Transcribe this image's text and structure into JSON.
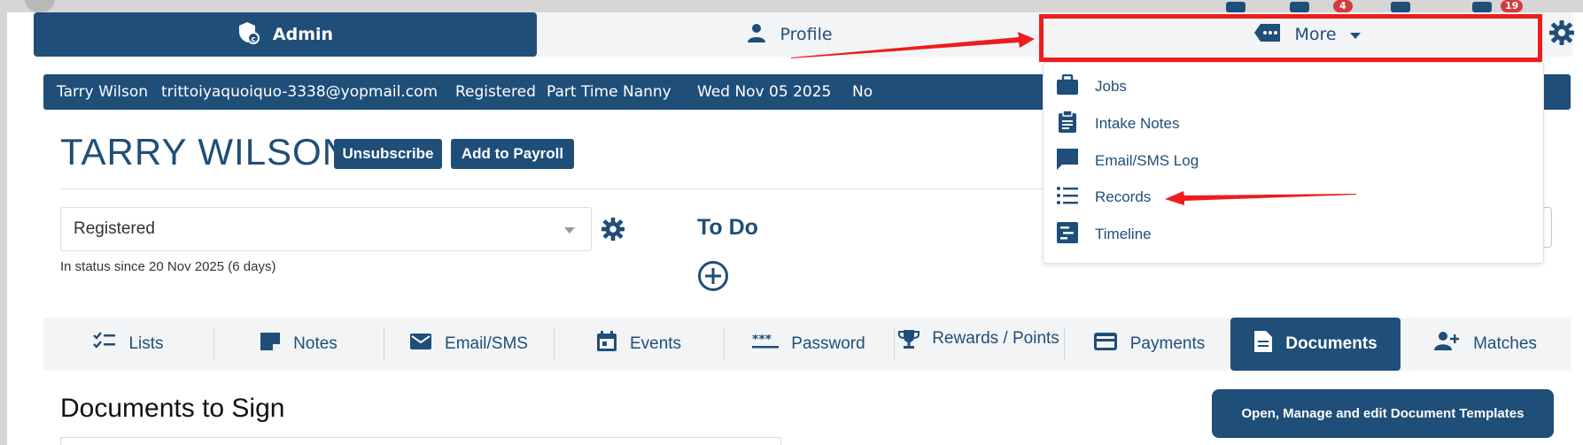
{
  "colors": {
    "primary": "#1f4e79",
    "panel": "#f2f4f6",
    "annotation_red": "#ee1c1c",
    "badge_red": "#d63a3a"
  },
  "browser": {
    "badge_1": "4",
    "badge_2": "19"
  },
  "top_tabs": [
    {
      "label": "Admin",
      "icon": "admin-shield-icon",
      "active": true
    },
    {
      "label": "Profile",
      "icon": "user-icon",
      "active": false
    },
    {
      "label": "More",
      "icon": "more-tag-icon",
      "active": false
    }
  ],
  "info_bar": {
    "name": "Tarry Wilson",
    "email": "trittoiyaquoiquo-3338@yopmail.com",
    "status": "Registered",
    "role": "Part Time Nanny",
    "date": "Wed Nov 05 2025",
    "flag": "No"
  },
  "client": {
    "name": "TARRY WILSON",
    "unsubscribe_label": "Unsubscribe",
    "payroll_label": "Add to Payroll"
  },
  "status": {
    "selected": "Registered",
    "since": "In status since 20 Nov 2025 (6 days)"
  },
  "todo": {
    "title": "To Do"
  },
  "more_menu": [
    {
      "label": "Jobs",
      "icon": "briefcase-icon"
    },
    {
      "label": "Intake Notes",
      "icon": "clipboard-icon"
    },
    {
      "label": "Email/SMS Log",
      "icon": "chat-icon"
    },
    {
      "label": "Records",
      "icon": "list-icon"
    },
    {
      "label": "Timeline",
      "icon": "timeline-icon"
    }
  ],
  "bottom_tabs": [
    {
      "label": "Lists",
      "icon": "checklist-icon"
    },
    {
      "label": "Notes",
      "icon": "note-icon"
    },
    {
      "label": "Email/SMS",
      "icon": "envelope-icon"
    },
    {
      "label": "Events",
      "icon": "calendar-icon"
    },
    {
      "label": "Password",
      "icon": "password-icon"
    },
    {
      "label": "Rewards / Points",
      "icon": "trophy-icon"
    },
    {
      "label": "Payments",
      "icon": "credit-card-icon"
    },
    {
      "label": "Documents",
      "icon": "document-icon",
      "active": true
    },
    {
      "label": "Matches",
      "icon": "user-add-icon"
    }
  ],
  "documents": {
    "title": "Documents to Sign",
    "templates_button": "Open, Manage and edit Document Templates"
  }
}
